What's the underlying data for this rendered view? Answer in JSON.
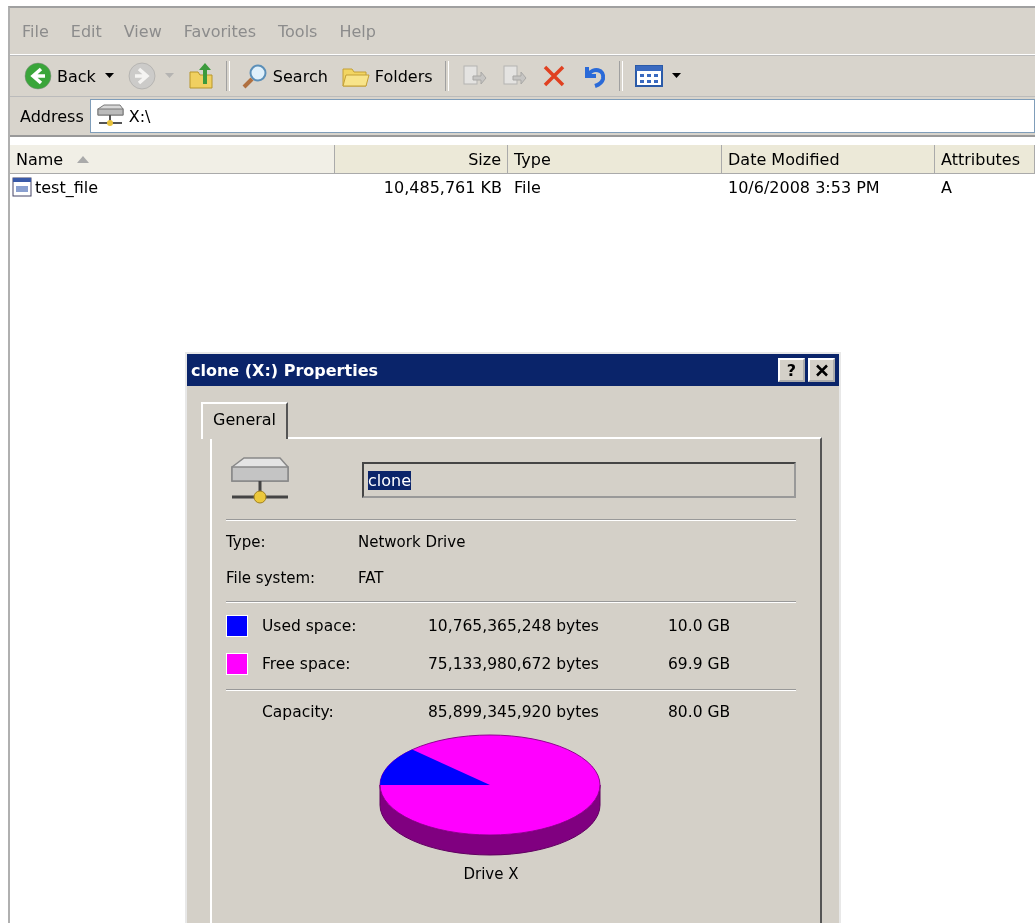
{
  "menu": [
    "File",
    "Edit",
    "View",
    "Favorites",
    "Tools",
    "Help"
  ],
  "toolbar": [
    {
      "kind": "back",
      "label": "Back",
      "disabled": false,
      "dropdown": true
    },
    {
      "kind": "forward",
      "disabled": true,
      "dropdown": true
    },
    {
      "kind": "up",
      "disabled": false
    },
    {
      "kind": "separator"
    },
    {
      "kind": "search",
      "label": "Search",
      "disabled": false
    },
    {
      "kind": "folders",
      "label": "Folders",
      "disabled": false
    },
    {
      "kind": "separator"
    },
    {
      "kind": "move",
      "disabled": true
    },
    {
      "kind": "copy",
      "disabled": true
    },
    {
      "kind": "delete",
      "disabled": false
    },
    {
      "kind": "undo",
      "disabled": false
    },
    {
      "kind": "separator"
    },
    {
      "kind": "views",
      "disabled": false,
      "dropdown": true
    }
  ],
  "address": {
    "label": "Address",
    "value": "X:\\"
  },
  "table": {
    "columns": [
      {
        "label": "Name",
        "sorted": true
      },
      {
        "label": "Size",
        "sorted": false
      },
      {
        "label": "Type",
        "sorted": false
      },
      {
        "label": "Date Modified",
        "sorted": false
      },
      {
        "label": "Attributes",
        "sorted": false
      }
    ],
    "rows": [
      {
        "name": "test_file",
        "size": "10,485,761 KB",
        "type": "File",
        "date": "10/6/2008 3:53 PM",
        "attributes": "A"
      }
    ]
  },
  "dialog": {
    "title": "clone (X:) Properties",
    "help": "?",
    "tabs": [
      {
        "label": "General",
        "selected": true
      }
    ],
    "name_field": {
      "value": "clone",
      "text_selected": true
    },
    "properties": [
      {
        "label": "Type:",
        "value": "Network Drive"
      },
      {
        "label": "File system:",
        "value": "FAT"
      }
    ],
    "space": [
      {
        "label": "Used space:",
        "bytes": "10,765,365,248 bytes",
        "size": "10.0 GB",
        "color": "#0000ff"
      },
      {
        "label": "Free space:",
        "bytes": "75,133,980,672 bytes",
        "size": "69.9 GB",
        "color": "#ff00ff"
      }
    ],
    "capacity": {
      "label": "Capacity:",
      "bytes": "85,899,345,920 bytes",
      "size": "80.0 GB"
    },
    "pie_caption": "Drive X"
  }
}
